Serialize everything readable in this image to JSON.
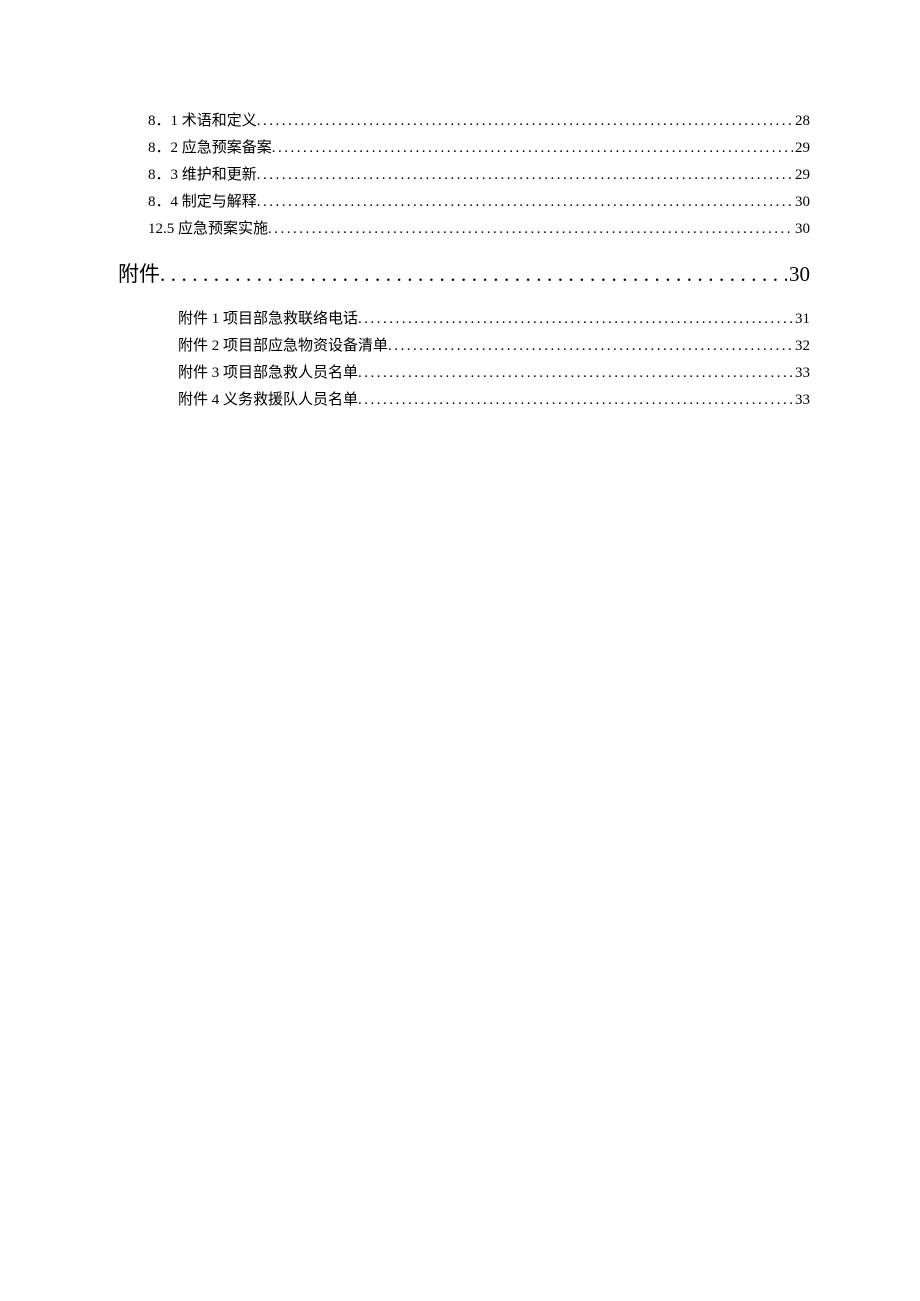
{
  "section1": {
    "entries": [
      {
        "label": "8．1 术语和定义",
        "page": "28"
      },
      {
        "label": "8．2 应急预案备案",
        "page": "29"
      },
      {
        "label": "8．3 维护和更新",
        "page": "29"
      },
      {
        "label": "8．4 制定与解释",
        "page": "30"
      },
      {
        "label": "12.5 应急预案实施",
        "page": "30"
      }
    ]
  },
  "heading": {
    "label": "附件",
    "page": "30"
  },
  "section2": {
    "entries": [
      {
        "label": "附件 1 项目部急救联络电话",
        "page": "31"
      },
      {
        "label": "附件 2 项目部应急物资设备清单",
        "page": "32"
      },
      {
        "label": "附件 3 项目部急救人员名单",
        "page": "33"
      },
      {
        "label": "附件 4 义务救援队人员名单",
        "page": "33"
      }
    ]
  }
}
